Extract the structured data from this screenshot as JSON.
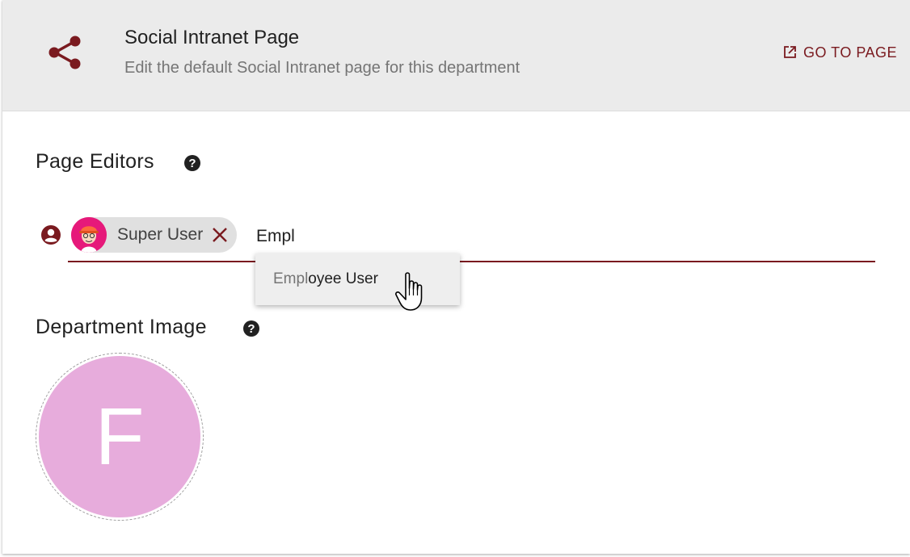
{
  "header": {
    "title": "Social Intranet Page",
    "subtitle": "Edit the default Social Intranet page for this department",
    "goto_label": "GO TO PAGE",
    "icon": "share-icon"
  },
  "editors": {
    "title": "Page Editors",
    "help_icon": "help-circle-icon",
    "selected": [
      {
        "name": "Super User",
        "avatar": "user-avatar"
      }
    ],
    "input_value": "Empl",
    "suggestions": [
      {
        "match": "Empl",
        "rest": "oyee User"
      }
    ]
  },
  "department_image": {
    "title": "Department Image",
    "help_icon": "help-circle-icon",
    "initial": "F",
    "color": "#e7acdc"
  },
  "colors": {
    "accent": "#7a1a1f",
    "header_bg": "#ebebeb",
    "avatar_bg": "#e6197a"
  }
}
